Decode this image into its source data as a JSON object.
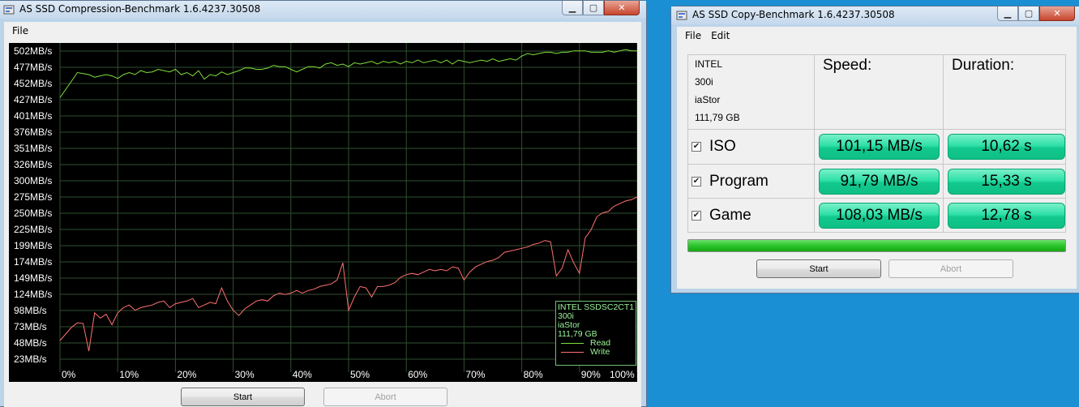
{
  "compression_window": {
    "title": "AS SSD Compression-Benchmark 1.6.4237.30508",
    "menu": [
      "File"
    ],
    "start_label": "Start",
    "abort_label": "Abort",
    "legend": {
      "device": "INTEL SSDSC2CT1",
      "model": "300i",
      "driver": "iaStor",
      "size": "111,79 GB",
      "read_label": "Read",
      "write_label": "Write",
      "read_color": "#7ee03a",
      "write_color": "#ff7070"
    }
  },
  "chart_data": {
    "type": "line",
    "y_tick_labels": [
      "502MB/s",
      "477MB/s",
      "452MB/s",
      "427MB/s",
      "401MB/s",
      "376MB/s",
      "351MB/s",
      "326MB/s",
      "300MB/s",
      "275MB/s",
      "250MB/s",
      "225MB/s",
      "199MB/s",
      "174MB/s",
      "149MB/s",
      "124MB/s",
      "98MB/s",
      "73MB/s",
      "48MB/s",
      "23MB/s"
    ],
    "x_tick_labels": [
      "0%",
      "10%",
      "20%",
      "30%",
      "40%",
      "50%",
      "60%",
      "70%",
      "80%",
      "90%",
      "100%"
    ],
    "xlim": [
      0,
      100
    ],
    "ylim": [
      10,
      510
    ],
    "grid": true,
    "legend_position": "bottom-right",
    "series": [
      {
        "name": "Read",
        "color": "#7ee03a",
        "points": [
          [
            0,
            427
          ],
          [
            2,
            452
          ],
          [
            3,
            465
          ],
          [
            5,
            462
          ],
          [
            6,
            458
          ],
          [
            7,
            460
          ],
          [
            8,
            462
          ],
          [
            9,
            460
          ],
          [
            10,
            456
          ],
          [
            11,
            462
          ],
          [
            12,
            465
          ],
          [
            13,
            462
          ],
          [
            14,
            468
          ],
          [
            15,
            465
          ],
          [
            16,
            466
          ],
          [
            17,
            470
          ],
          [
            18,
            468
          ],
          [
            19,
            466
          ],
          [
            20,
            470
          ],
          [
            21,
            462
          ],
          [
            22,
            465
          ],
          [
            23,
            460
          ],
          [
            24,
            468
          ],
          [
            25,
            455
          ],
          [
            26,
            462
          ],
          [
            27,
            460
          ],
          [
            28,
            466
          ],
          [
            29,
            462
          ],
          [
            30,
            465
          ],
          [
            31,
            468
          ],
          [
            32,
            472
          ],
          [
            33,
            472
          ],
          [
            34,
            470
          ],
          [
            35,
            470
          ],
          [
            36,
            472
          ],
          [
            37,
            476
          ],
          [
            38,
            474
          ],
          [
            39,
            474
          ],
          [
            40,
            470
          ],
          [
            41,
            466
          ],
          [
            42,
            470
          ],
          [
            43,
            474
          ],
          [
            44,
            474
          ],
          [
            45,
            472
          ],
          [
            46,
            478
          ],
          [
            47,
            480
          ],
          [
            48,
            476
          ],
          [
            49,
            478
          ],
          [
            50,
            474
          ],
          [
            51,
            480
          ],
          [
            52,
            478
          ],
          [
            53,
            480
          ],
          [
            54,
            482
          ],
          [
            55,
            478
          ],
          [
            56,
            482
          ],
          [
            57,
            480
          ],
          [
            58,
            482
          ],
          [
            59,
            478
          ],
          [
            60,
            482
          ],
          [
            61,
            480
          ],
          [
            62,
            484
          ],
          [
            63,
            480
          ],
          [
            64,
            482
          ],
          [
            65,
            484
          ],
          [
            66,
            480
          ],
          [
            67,
            484
          ],
          [
            68,
            478
          ],
          [
            69,
            484
          ],
          [
            70,
            482
          ],
          [
            71,
            480
          ],
          [
            72,
            482
          ],
          [
            73,
            484
          ],
          [
            74,
            482
          ],
          [
            75,
            486
          ],
          [
            76,
            482
          ],
          [
            77,
            484
          ],
          [
            78,
            486
          ],
          [
            79,
            484
          ],
          [
            80,
            490
          ],
          [
            81,
            494
          ],
          [
            82,
            492
          ],
          [
            83,
            494
          ],
          [
            84,
            496
          ],
          [
            85,
            496
          ],
          [
            86,
            494
          ],
          [
            87,
            496
          ],
          [
            88,
            496
          ],
          [
            89,
            498
          ],
          [
            90,
            498
          ],
          [
            91,
            498
          ],
          [
            92,
            496
          ],
          [
            93,
            496
          ],
          [
            94,
            496
          ],
          [
            95,
            498
          ],
          [
            96,
            496
          ],
          [
            97,
            498
          ],
          [
            98,
            500
          ],
          [
            99,
            498
          ],
          [
            100,
            498
          ]
        ]
      },
      {
        "name": "Write",
        "color": "#ff7070",
        "points": [
          [
            0,
            58
          ],
          [
            2,
            78
          ],
          [
            3,
            85
          ],
          [
            4,
            84
          ],
          [
            5,
            42
          ],
          [
            6,
            100
          ],
          [
            7,
            92
          ],
          [
            8,
            98
          ],
          [
            9,
            82
          ],
          [
            10,
            100
          ],
          [
            11,
            108
          ],
          [
            12,
            112
          ],
          [
            13,
            104
          ],
          [
            14,
            108
          ],
          [
            15,
            110
          ],
          [
            16,
            112
          ],
          [
            17,
            116
          ],
          [
            18,
            118
          ],
          [
            19,
            108
          ],
          [
            20,
            114
          ],
          [
            21,
            116
          ],
          [
            22,
            118
          ],
          [
            23,
            122
          ],
          [
            24,
            108
          ],
          [
            25,
            112
          ],
          [
            26,
            116
          ],
          [
            27,
            114
          ],
          [
            28,
            138
          ],
          [
            29,
            118
          ],
          [
            30,
            104
          ],
          [
            31,
            96
          ],
          [
            32,
            106
          ],
          [
            33,
            112
          ],
          [
            34,
            118
          ],
          [
            35,
            120
          ],
          [
            36,
            118
          ],
          [
            37,
            126
          ],
          [
            38,
            130
          ],
          [
            39,
            128
          ],
          [
            40,
            130
          ],
          [
            41,
            134
          ],
          [
            42,
            130
          ],
          [
            43,
            134
          ],
          [
            44,
            136
          ],
          [
            45,
            140
          ],
          [
            46,
            142
          ],
          [
            47,
            144
          ],
          [
            48,
            150
          ],
          [
            49,
            176
          ],
          [
            50,
            104
          ],
          [
            51,
            124
          ],
          [
            52,
            140
          ],
          [
            53,
            138
          ],
          [
            54,
            124
          ],
          [
            55,
            140
          ],
          [
            56,
            140
          ],
          [
            57,
            142
          ],
          [
            58,
            146
          ],
          [
            59,
            154
          ],
          [
            60,
            158
          ],
          [
            61,
            160
          ],
          [
            62,
            158
          ],
          [
            63,
            162
          ],
          [
            64,
            166
          ],
          [
            65,
            164
          ],
          [
            66,
            166
          ],
          [
            67,
            164
          ],
          [
            68,
            170
          ],
          [
            69,
            168
          ],
          [
            70,
            150
          ],
          [
            71,
            162
          ],
          [
            72,
            170
          ],
          [
            73,
            174
          ],
          [
            74,
            178
          ],
          [
            75,
            180
          ],
          [
            76,
            184
          ],
          [
            77,
            192
          ],
          [
            78,
            194
          ],
          [
            79,
            196
          ],
          [
            80,
            198
          ],
          [
            81,
            200
          ],
          [
            82,
            204
          ],
          [
            83,
            206
          ],
          [
            84,
            210
          ],
          [
            85,
            208
          ],
          [
            86,
            156
          ],
          [
            87,
            168
          ],
          [
            88,
            196
          ],
          [
            89,
            176
          ],
          [
            90,
            160
          ],
          [
            91,
            214
          ],
          [
            92,
            226
          ],
          [
            93,
            246
          ],
          [
            94,
            252
          ],
          [
            95,
            254
          ],
          [
            96,
            262
          ],
          [
            97,
            266
          ],
          [
            98,
            270
          ],
          [
            99,
            272
          ],
          [
            100,
            276
          ]
        ]
      }
    ]
  },
  "copy_window": {
    "title": "AS SSD Copy-Benchmark 1.6.4237.30508",
    "menu": [
      "File",
      "Edit"
    ],
    "device_info": [
      "INTEL",
      "300i",
      "iaStor",
      "111,79 GB"
    ],
    "speed_header": "Speed:",
    "duration_header": "Duration:",
    "rows": [
      {
        "name": "ISO",
        "checked": true,
        "speed": "101,15 MB/s",
        "duration": "10,62 s"
      },
      {
        "name": "Program",
        "checked": true,
        "speed": "91,79 MB/s",
        "duration": "15,33 s"
      },
      {
        "name": "Game",
        "checked": true,
        "speed": "108,03 MB/s",
        "duration": "12,78 s"
      }
    ],
    "progress_fraction": 1.0,
    "start_label": "Start",
    "abort_label": "Abort",
    "pill_color": "#2fe0a8"
  }
}
